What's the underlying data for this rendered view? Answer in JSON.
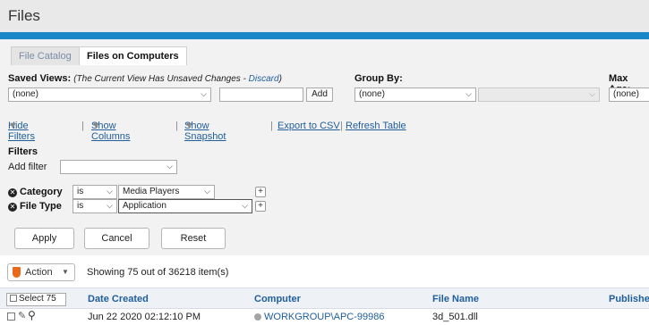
{
  "header": {
    "title": "Files"
  },
  "tabs": [
    {
      "label": "File Catalog",
      "active": false
    },
    {
      "label": "Files on Computers",
      "active": true
    }
  ],
  "saved_views": {
    "label": "Saved Views:",
    "note_prefix": "(The Current View Has Unsaved Changes - ",
    "discard": "Discard",
    "note_suffix": ")",
    "value": "(none)",
    "name_value": "",
    "add_label": "Add"
  },
  "group_by": {
    "label": "Group By:",
    "value": "(none)",
    "secondary_value": ""
  },
  "max_age": {
    "label": "Max Age:",
    "value": "(none)"
  },
  "toolbar_links": {
    "hide_filters": "Hide Filters",
    "show_columns": "Show Columns",
    "show_snapshot": "Show Snapshot",
    "export_csv": "Export to CSV",
    "refresh": "Refresh Table"
  },
  "filters": {
    "heading": "Filters",
    "add_filter_label": "Add filter",
    "add_filter_value": "",
    "rows": [
      {
        "field": "Category",
        "operator": "is",
        "value": "Media Players"
      },
      {
        "field": "File Type",
        "operator": "is",
        "value": "Application"
      }
    ],
    "plus": "+"
  },
  "buttons": {
    "apply": "Apply",
    "cancel": "Cancel",
    "reset": "Reset"
  },
  "action": {
    "label": "Action",
    "status": "Showing 75 out of 36218 item(s)"
  },
  "table": {
    "select_label": "Select 75",
    "columns": [
      "Date Created",
      "Computer",
      "File Name",
      "Publishe"
    ],
    "rows": [
      {
        "date": "Jun 22 2020 02:12:10 PM",
        "computer": "WORKGROUP\\APC-99986",
        "file": "3d_501.dll",
        "publisher": ""
      }
    ]
  },
  "colors": {
    "accent": "#1a87c9",
    "link": "#1f5d9b",
    "action_icon": "#e86a1a"
  }
}
